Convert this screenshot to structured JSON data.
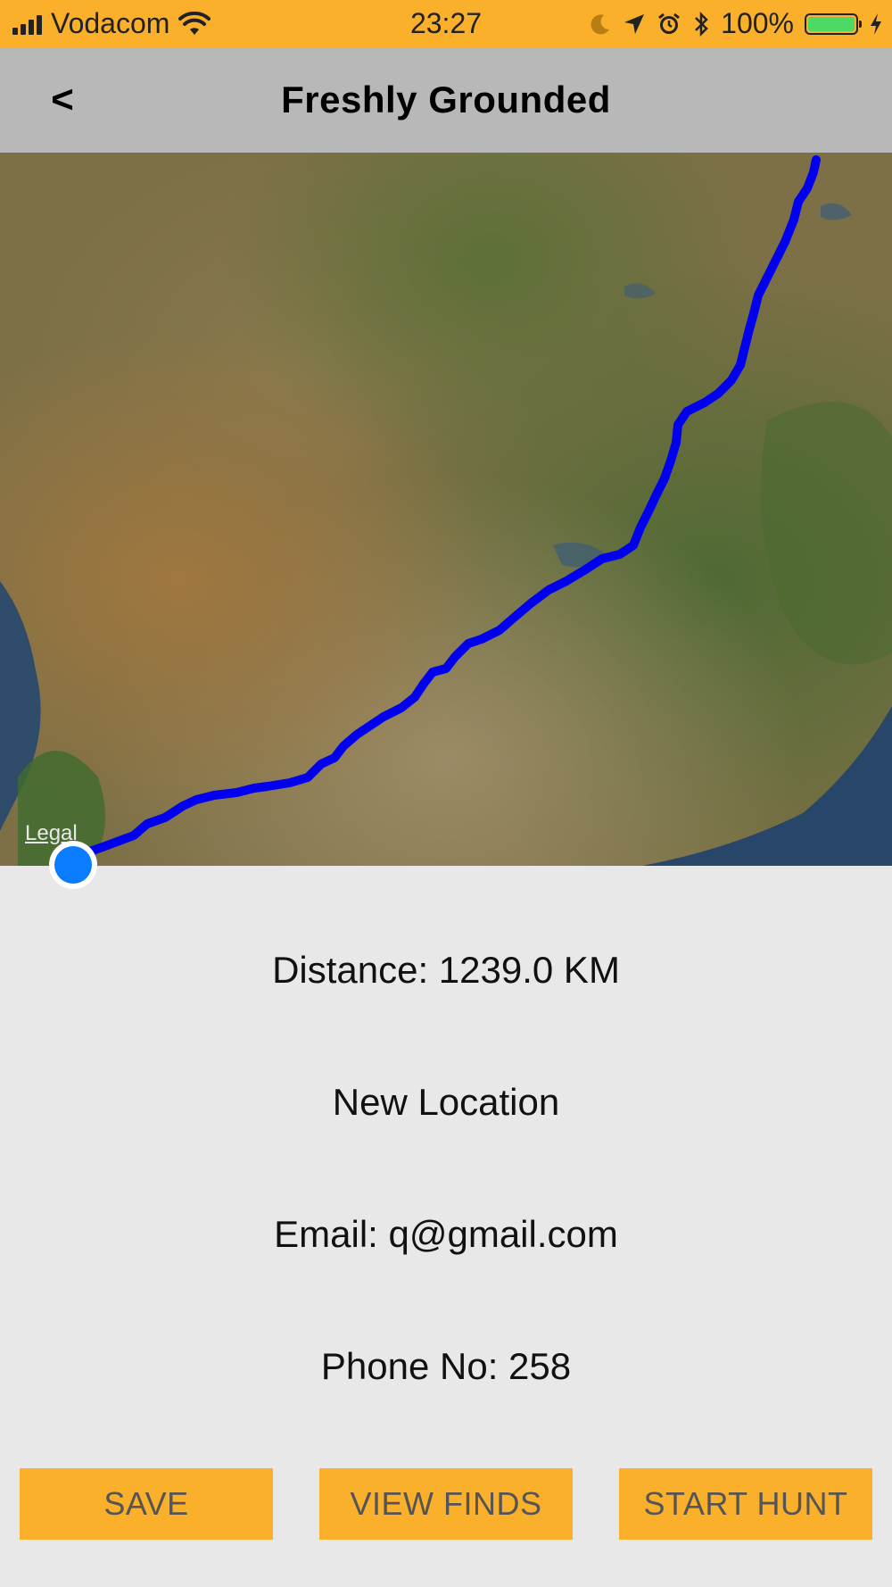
{
  "status_bar": {
    "carrier": "Vodacom",
    "time": "23:27",
    "battery_percent": "100%",
    "battery_level": 1.0,
    "icons": [
      "signal-icon",
      "wifi-icon",
      "moon-icon",
      "location-arrow-icon",
      "alarm-icon",
      "bluetooth-icon",
      "battery-icon",
      "charging-icon"
    ]
  },
  "nav": {
    "back_label": "<",
    "title": "Freshly Grounded"
  },
  "map": {
    "legal_label": "Legal",
    "route_color": "#0000ee",
    "location_dot_color": "#0a7cff"
  },
  "details": {
    "distance": "Distance: 1239.0 KM",
    "location_name": "New Location",
    "email": "Email: q@gmail.com",
    "phone": "Phone No: 258"
  },
  "buttons": {
    "save": "SAVE",
    "view_finds": "VIEW FINDS",
    "start_hunt": "START HUNT"
  },
  "colors": {
    "accent": "#fbb02b",
    "nav_bg": "#b8b8b8",
    "page_bg": "#e8e8e8"
  }
}
